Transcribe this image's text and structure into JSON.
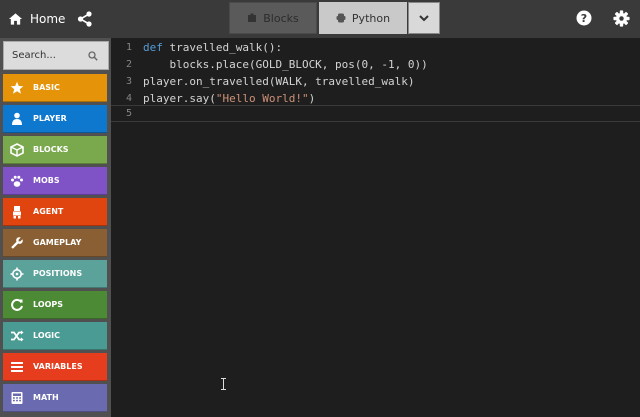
{
  "topbar": {
    "home_label": "Home",
    "tabs": [
      {
        "label": "Blocks",
        "active": false
      },
      {
        "label": "Python",
        "active": true
      }
    ]
  },
  "sidebar": {
    "search_placeholder": "Search...",
    "categories": [
      {
        "label": "BASIC",
        "color": "#e5940a",
        "icon": "star-icon"
      },
      {
        "label": "PLAYER",
        "color": "#0e78cf",
        "icon": "person-icon"
      },
      {
        "label": "BLOCKS",
        "color": "#7aa84d",
        "icon": "cube-icon"
      },
      {
        "label": "MOBS",
        "color": "#7f52c6",
        "icon": "paw-icon"
      },
      {
        "label": "AGENT",
        "color": "#e0450f",
        "icon": "agent-icon"
      },
      {
        "label": "GAMEPLAY",
        "color": "#8a5f33",
        "icon": "wrench-icon"
      },
      {
        "label": "POSITIONS",
        "color": "#5aa29a",
        "icon": "crosshair-icon"
      },
      {
        "label": "LOOPS",
        "color": "#4d8a36",
        "icon": "refresh-icon"
      },
      {
        "label": "LOGIC",
        "color": "#4a9b93",
        "icon": "shuffle-icon"
      },
      {
        "label": "VARIABLES",
        "color": "#e53d1e",
        "icon": "list-icon"
      },
      {
        "label": "MATH",
        "color": "#6a6ab0",
        "icon": "calculator-icon"
      }
    ]
  },
  "editor": {
    "line_numbers": [
      "1",
      "2",
      "3",
      "4",
      "5"
    ],
    "lines": [
      {
        "kw": "def",
        "rest": " travelled_walk():",
        "str": "",
        "tail": ""
      },
      {
        "kw": "",
        "rest": "    blocks.place(GOLD_BLOCK, pos(0, -1, 0))",
        "str": "",
        "tail": ""
      },
      {
        "kw": "",
        "rest": "player.on_travelled(WALK, travelled_walk)",
        "str": "",
        "tail": ""
      },
      {
        "kw": "",
        "rest": "player.say(",
        "str": "\"Hello World!\"",
        "tail": ")"
      },
      {
        "kw": "",
        "rest": "",
        "str": "",
        "tail": ""
      }
    ]
  }
}
